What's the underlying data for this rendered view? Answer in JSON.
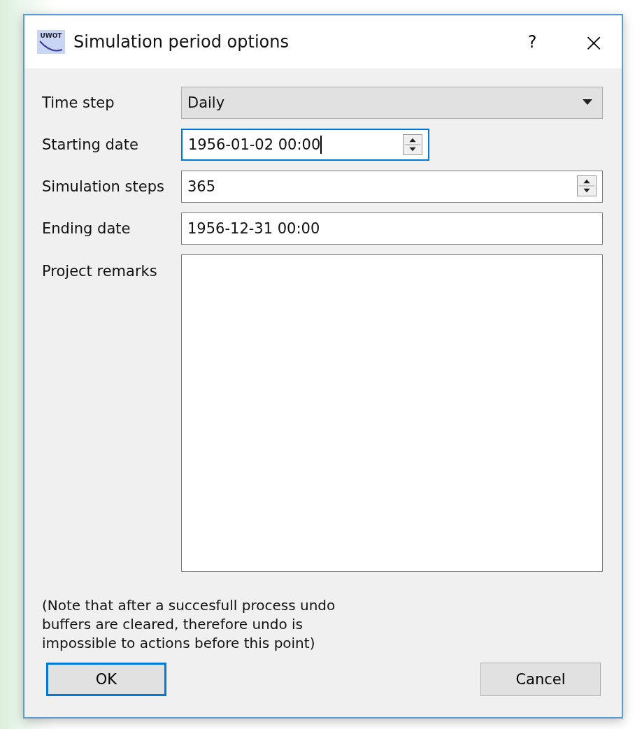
{
  "window": {
    "logo_text": "UWOT",
    "title": "Simulation period options",
    "help": "?",
    "close": "×"
  },
  "fields": [
    {
      "label": "Time step",
      "kind": "combo",
      "value": "Daily",
      "focused": false
    },
    {
      "label": "Starting date",
      "kind": "spin",
      "value": "1956-01-02 00:00",
      "focused": true
    },
    {
      "label": "Simulation steps",
      "kind": "spin-wide",
      "value": "365",
      "focused": false
    },
    {
      "label": "Ending date",
      "kind": "text",
      "value": "1956-12-31 00:00",
      "focused": false
    },
    {
      "label": "Project remarks",
      "kind": "textarea",
      "focused": false
    }
  ],
  "note": "(Note that after a succesfull process undo\nbuffers are cleared, therefore undo is\nimpossible to actions before this point)",
  "buttons": [
    {
      "label": "OK",
      "default": true
    },
    {
      "label": "Cancel",
      "default": false
    }
  ]
}
